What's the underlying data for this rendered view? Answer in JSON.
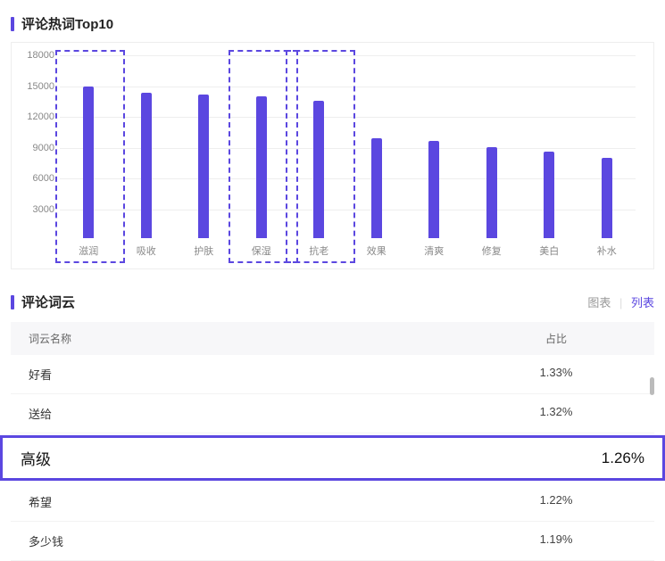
{
  "titles": {
    "top10": "评论热词Top10",
    "cloud": "评论词云"
  },
  "view_tabs": {
    "chart": "图表",
    "list": "列表",
    "active": "list"
  },
  "table_headers": {
    "name": "词云名称",
    "pct": "占比"
  },
  "chart_data": {
    "type": "bar",
    "categories": [
      "滋润",
      "吸收",
      "护肤",
      "保湿",
      "抗老",
      "效果",
      "清爽",
      "修复",
      "美白",
      "补水"
    ],
    "values": [
      14800,
      14200,
      14000,
      13800,
      13400,
      9700,
      9500,
      8900,
      8400,
      7800
    ],
    "highlighted_categories": [
      "滋润",
      "保湿",
      "抗老"
    ],
    "ylim": [
      0,
      18000
    ],
    "yticks": [
      3000,
      6000,
      9000,
      12000,
      15000,
      18000
    ],
    "xlabel": "",
    "ylabel": "",
    "title": ""
  },
  "word_cloud_rows": [
    {
      "name": "好看",
      "pct": "1.33%"
    },
    {
      "name": "送给",
      "pct": "1.32%"
    },
    {
      "name": "高级",
      "pct": "1.26%",
      "highlighted": true
    },
    {
      "name": "希望",
      "pct": "1.22%"
    },
    {
      "name": "多少钱",
      "pct": "1.19%"
    }
  ]
}
